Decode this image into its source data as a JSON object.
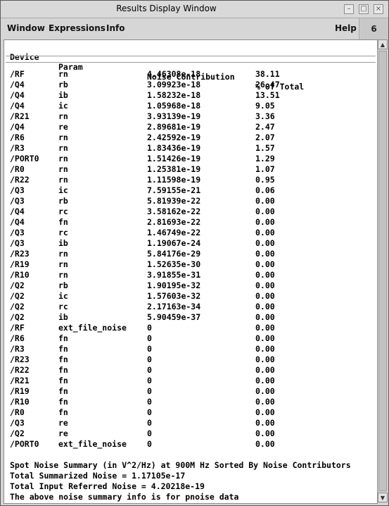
{
  "window": {
    "title": "Results Display Window",
    "buttons": [
      "minimize",
      "maximize",
      "close"
    ]
  },
  "menubar": {
    "items": [
      "Window",
      "Expressions",
      "Info"
    ],
    "help": "Help",
    "badge": "6"
  },
  "table": {
    "columns": [
      "Device",
      "Param",
      "Noise Contribution",
      "% Of Total"
    ],
    "rows": [
      [
        "/RF",
        "rn",
        "4.46308e-18",
        "38.11"
      ],
      [
        "/Q4",
        "rb",
        "3.09923e-18",
        "26.47"
      ],
      [
        "/Q4",
        "ib",
        "1.58232e-18",
        "13.51"
      ],
      [
        "/Q4",
        "ic",
        "1.05968e-18",
        "9.05"
      ],
      [
        "/R21",
        "rn",
        "3.93139e-19",
        "3.36"
      ],
      [
        "/Q4",
        "re",
        "2.89681e-19",
        "2.47"
      ],
      [
        "/R6",
        "rn",
        "2.42592e-19",
        "2.07"
      ],
      [
        "/R3",
        "rn",
        "1.83436e-19",
        "1.57"
      ],
      [
        "/PORT0",
        "rn",
        "1.51426e-19",
        "1.29"
      ],
      [
        "/R0",
        "rn",
        "1.25381e-19",
        "1.07"
      ],
      [
        "/R22",
        "rn",
        "1.11598e-19",
        "0.95"
      ],
      [
        "/Q3",
        "ic",
        "7.59155e-21",
        "0.06"
      ],
      [
        "/Q3",
        "rb",
        "5.81939e-22",
        "0.00"
      ],
      [
        "/Q4",
        "rc",
        "3.58162e-22",
        "0.00"
      ],
      [
        "/Q4",
        "fn",
        "2.81693e-22",
        "0.00"
      ],
      [
        "/Q3",
        "rc",
        "1.46749e-22",
        "0.00"
      ],
      [
        "/Q3",
        "ib",
        "1.19067e-24",
        "0.00"
      ],
      [
        "/R23",
        "rn",
        "5.84176e-29",
        "0.00"
      ],
      [
        "/R19",
        "rn",
        "1.52635e-30",
        "0.00"
      ],
      [
        "/R10",
        "rn",
        "3.91855e-31",
        "0.00"
      ],
      [
        "/Q2",
        "rb",
        "1.90195e-32",
        "0.00"
      ],
      [
        "/Q2",
        "ic",
        "1.57603e-32",
        "0.00"
      ],
      [
        "/Q2",
        "rc",
        "2.17163e-34",
        "0.00"
      ],
      [
        "/Q2",
        "ib",
        "5.90459e-37",
        "0.00"
      ],
      [
        "/RF",
        "ext_file_noise",
        "0",
        "0.00"
      ],
      [
        "/R6",
        "fn",
        "0",
        "0.00"
      ],
      [
        "/R3",
        "fn",
        "0",
        "0.00"
      ],
      [
        "/R23",
        "fn",
        "0",
        "0.00"
      ],
      [
        "/R22",
        "fn",
        "0",
        "0.00"
      ],
      [
        "/R21",
        "fn",
        "0",
        "0.00"
      ],
      [
        "/R19",
        "fn",
        "0",
        "0.00"
      ],
      [
        "/R10",
        "fn",
        "0",
        "0.00"
      ],
      [
        "/R0",
        "fn",
        "0",
        "0.00"
      ],
      [
        "/Q3",
        "re",
        "0",
        "0.00"
      ],
      [
        "/Q2",
        "re",
        "0",
        "0.00"
      ],
      [
        "/PORT0",
        "ext_file_noise",
        "0",
        "0.00"
      ]
    ]
  },
  "summary": {
    "line1": "Spot Noise Summary (in V^2/Hz) at 900M Hz Sorted By Noise Contributors",
    "line2": "Total Summarized Noise = 1.17105e-17",
    "line3": "Total Input Referred Noise = 4.20218e-19",
    "line4": "The above noise summary info is for pnoise data"
  }
}
